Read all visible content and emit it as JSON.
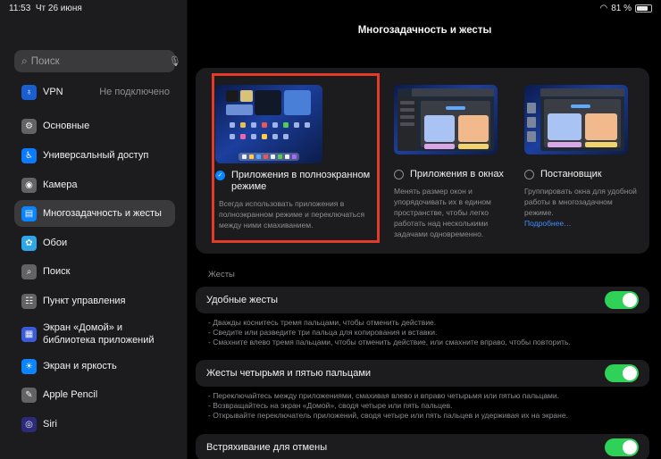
{
  "status": {
    "time": "11:53",
    "date": "Чт 26 июня",
    "battery": "81 %",
    "battery_level": 0.81
  },
  "sidebar": {
    "search_placeholder": "Поиск",
    "items": [
      {
        "label": "VPN",
        "value": "Не подключено",
        "icon": "vpn-icon",
        "color": "#1a5fd0"
      },
      {
        "label": "Основные",
        "icon": "gear-icon",
        "color": "#636366"
      },
      {
        "label": "Универсальный доступ",
        "icon": "accessibility-icon",
        "color": "#0a7aff"
      },
      {
        "label": "Камера",
        "icon": "camera-icon",
        "color": "#636366"
      },
      {
        "label": "Многозадачность и жесты",
        "icon": "multitasking-icon",
        "color": "#0a84ff"
      },
      {
        "label": "Обои",
        "icon": "wallpaper-icon",
        "color": "#2fa6e8"
      },
      {
        "label": "Поиск",
        "icon": "search-icon",
        "color": "#636366"
      },
      {
        "label": "Пункт управления",
        "icon": "control-center-icon",
        "color": "#636366"
      },
      {
        "label": "Экран «Домой» и библиотека приложений",
        "icon": "home-screen-icon",
        "color": "#3b5cd9"
      },
      {
        "label": "Экран и яркость",
        "icon": "brightness-icon",
        "color": "#0a84ff"
      },
      {
        "label": "Apple Pencil",
        "icon": "pencil-icon",
        "color": "#636366"
      },
      {
        "label": "Siri",
        "icon": "siri-icon",
        "color": "#2b2b7a"
      }
    ]
  },
  "main": {
    "title": "Многозадачность и жесты",
    "options": [
      {
        "label": "Приложения в полноэкранном режиме",
        "desc": "Всегда использовать приложения в полноэкранном режиме и переключаться между ними смахиванием.",
        "selected": true
      },
      {
        "label": "Приложения в окнах",
        "desc": "Менять размер окон и упорядочивать их в едином пространстве, чтобы легко работать над несколькими задачами одновременно.",
        "selected": false
      },
      {
        "label": "Постановщик",
        "desc": "Группировать окна для удобной работы в многозадачном режиме.",
        "link": "Подробнее…",
        "selected": false
      }
    ],
    "gestures_header": "Жесты",
    "rows": [
      {
        "label": "Удобные жесты",
        "on": true,
        "notes": [
          "- Дважды коснитесь тремя пальцами, чтобы отменить действие.",
          "- Сведите или разведите три пальца для копирования и вставки.",
          "- Смахните влево тремя пальцами, чтобы отменить действие, или смахните вправо, чтобы повторить."
        ]
      },
      {
        "label": "Жесты четырьмя и пятью пальцами",
        "on": true,
        "notes": [
          "- Переключайтесь между приложениями, смахивая влево и вправо четырьмя или пятью пальцами.",
          "- Возвращайтесь на экран «Домой», сводя четыре или пять пальцев.",
          "- Открывайте переключатель приложений, сводя четыре или пять пальцев и удерживая их на экране."
        ]
      },
      {
        "label": "Встряхивание для отмены",
        "on": true,
        "notes": []
      }
    ]
  }
}
